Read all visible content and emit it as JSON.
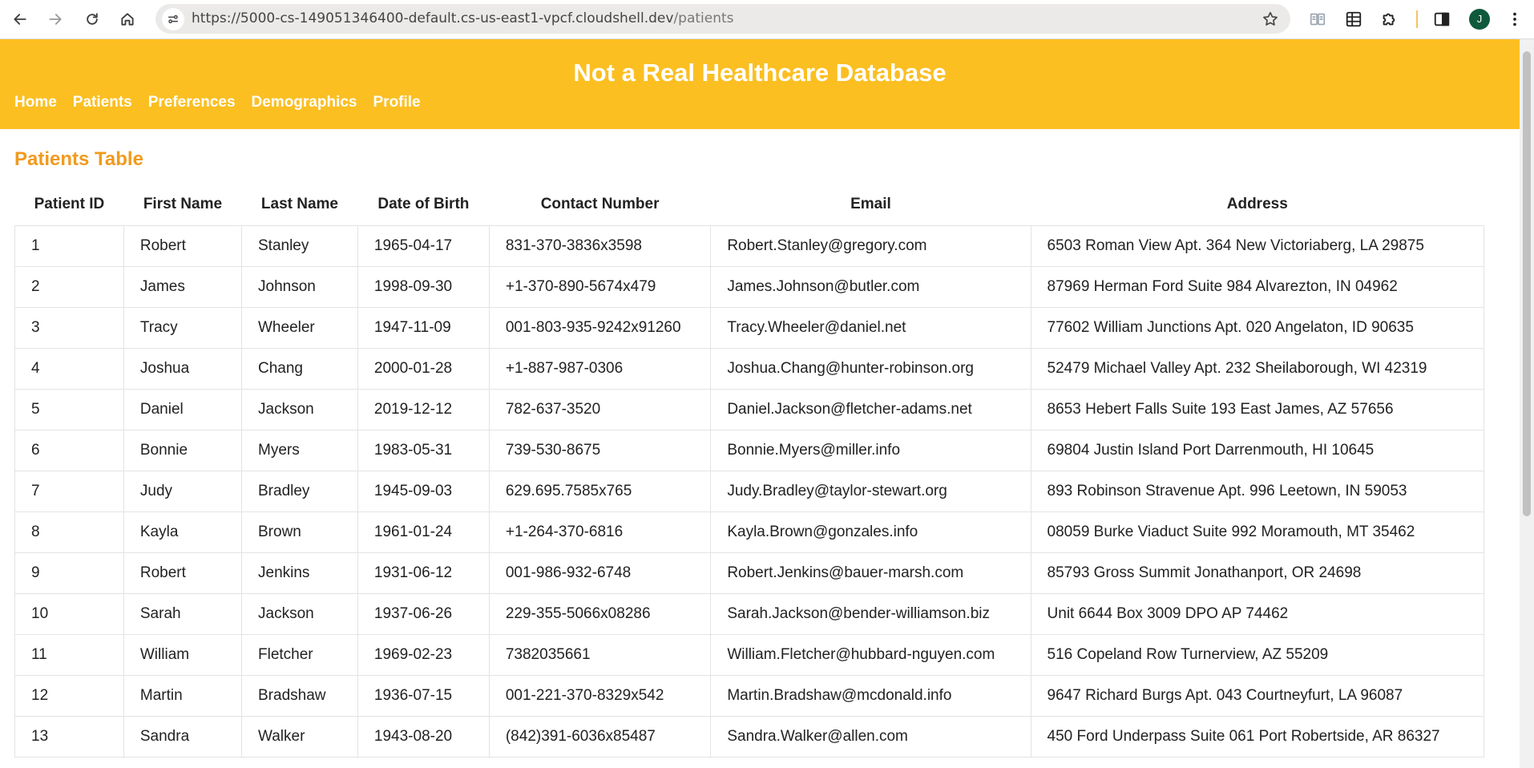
{
  "browser": {
    "url_host": "https://5000-cs-149051346400-default.cs-us-east1-vpcf.cloudshell.dev",
    "url_path": "/patients",
    "profile_initial": "J"
  },
  "site": {
    "title": "Not a Real Healthcare Database",
    "nav": [
      "Home",
      "Patients",
      "Preferences",
      "Demographics",
      "Profile"
    ]
  },
  "section_title": "Patients Table",
  "table": {
    "columns": [
      "Patient ID",
      "First Name",
      "Last Name",
      "Date of Birth",
      "Contact Number",
      "Email",
      "Address"
    ],
    "rows": [
      [
        "1",
        "Robert",
        "Stanley",
        "1965-04-17",
        "831-370-3836x3598",
        "Robert.Stanley@gregory.com",
        "6503 Roman View Apt. 364 New Victoriaberg, LA 29875"
      ],
      [
        "2",
        "James",
        "Johnson",
        "1998-09-30",
        "+1-370-890-5674x479",
        "James.Johnson@butler.com",
        "87969 Herman Ford Suite 984 Alvarezton, IN 04962"
      ],
      [
        "3",
        "Tracy",
        "Wheeler",
        "1947-11-09",
        "001-803-935-9242x91260",
        "Tracy.Wheeler@daniel.net",
        "77602 William Junctions Apt. 020 Angelaton, ID 90635"
      ],
      [
        "4",
        "Joshua",
        "Chang",
        "2000-01-28",
        "+1-887-987-0306",
        "Joshua.Chang@hunter-robinson.org",
        "52479 Michael Valley Apt. 232 Sheilaborough, WI 42319"
      ],
      [
        "5",
        "Daniel",
        "Jackson",
        "2019-12-12",
        "782-637-3520",
        "Daniel.Jackson@fletcher-adams.net",
        "8653 Hebert Falls Suite 193 East James, AZ 57656"
      ],
      [
        "6",
        "Bonnie",
        "Myers",
        "1983-05-31",
        "739-530-8675",
        "Bonnie.Myers@miller.info",
        "69804 Justin Island Port Darrenmouth, HI 10645"
      ],
      [
        "7",
        "Judy",
        "Bradley",
        "1945-09-03",
        "629.695.7585x765",
        "Judy.Bradley@taylor-stewart.org",
        "893 Robinson Stravenue Apt. 996 Leetown, IN 59053"
      ],
      [
        "8",
        "Kayla",
        "Brown",
        "1961-01-24",
        "+1-264-370-6816",
        "Kayla.Brown@gonzales.info",
        "08059 Burke Viaduct Suite 992 Moramouth, MT 35462"
      ],
      [
        "9",
        "Robert",
        "Jenkins",
        "1931-06-12",
        "001-986-932-6748",
        "Robert.Jenkins@bauer-marsh.com",
        "85793 Gross Summit Jonathanport, OR 24698"
      ],
      [
        "10",
        "Sarah",
        "Jackson",
        "1937-06-26",
        "229-355-5066x08286",
        "Sarah.Jackson@bender-williamson.biz",
        "Unit 6644 Box 3009 DPO AP 74462"
      ],
      [
        "11",
        "William",
        "Fletcher",
        "1969-02-23",
        "7382035661",
        "William.Fletcher@hubbard-nguyen.com",
        "516 Copeland Row Turnerview, AZ 55209"
      ],
      [
        "12",
        "Martin",
        "Bradshaw",
        "1936-07-15",
        "001-221-370-8329x542",
        "Martin.Bradshaw@mcdonald.info",
        "9647 Richard Burgs Apt. 043 Courtneyfurt, LA 96087"
      ],
      [
        "13",
        "Sandra",
        "Walker",
        "1943-08-20",
        "(842)391-6036x85487",
        "Sandra.Walker@allen.com",
        "450 Ford Underpass Suite 061 Port Robertside, AR 86327"
      ]
    ]
  },
  "colors": {
    "header_bg": "#fbbf22",
    "section_title": "#f19a1c",
    "nav_text": "#ffffff"
  },
  "icons": {
    "back": "arrow-left-icon",
    "forward": "arrow-right-icon",
    "reload": "reload-icon",
    "home": "home-icon",
    "site_info": "tune-icon",
    "bookmark": "star-icon",
    "extensions": [
      "reading-list-icon",
      "table-icon",
      "puzzle-icon",
      "sidebar-icon"
    ],
    "menu": "kebab-menu-icon"
  }
}
